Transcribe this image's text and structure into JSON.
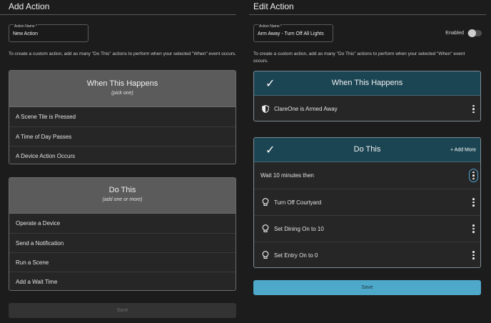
{
  "left": {
    "title": "Add Action",
    "action_name_label": "Action Name *",
    "action_name_value": "New Action",
    "description": "To create a custom action, add as many \"Do This\" actions to perform when your selected \"When\" event occurs.",
    "when": {
      "title": "When This Happens",
      "subtitle": "(pick one)",
      "options": [
        "A Scene Tile is Pressed",
        "A Time of Day Passes",
        "A Device Action Occurs"
      ]
    },
    "do": {
      "title": "Do This",
      "subtitle": "(add one or more)",
      "options": [
        "Operate a Device",
        "Send a Notification",
        "Run a Scene",
        "Add a Wait Time"
      ]
    },
    "save_label": "Save"
  },
  "right": {
    "title": "Edit Action",
    "action_name_label": "Action Name *",
    "action_name_value": "Arm Away - Turn Off All Lights",
    "enabled_label": "Enabled",
    "enabled": false,
    "description": "To create a custom action, add as many \"Do This\" actions to perform when your selected \"When\" event occurs.",
    "when": {
      "title": "When This Happens",
      "trigger": {
        "icon": "shield-icon",
        "label": "ClareOne is Armed Away"
      }
    },
    "do": {
      "title": "Do This",
      "add_more_label": "+ Add More",
      "steps": [
        {
          "icon": "",
          "label": "Wait 10 minutes then"
        },
        {
          "icon": "lightbulb-icon",
          "label": "Turn Off Courtyard"
        },
        {
          "icon": "lightbulb-icon",
          "label": "Set Dining On to 10"
        },
        {
          "icon": "lightbulb-icon",
          "label": "Set Entry On to 0"
        }
      ]
    },
    "save_label": "Save"
  },
  "colors": {
    "background": "#1c1c1c",
    "gray_header": "#5b5b5b",
    "teal_header": "#1c4553",
    "accent_blue": "#4ea8c9",
    "focus_ring": "#4aa6d6"
  }
}
